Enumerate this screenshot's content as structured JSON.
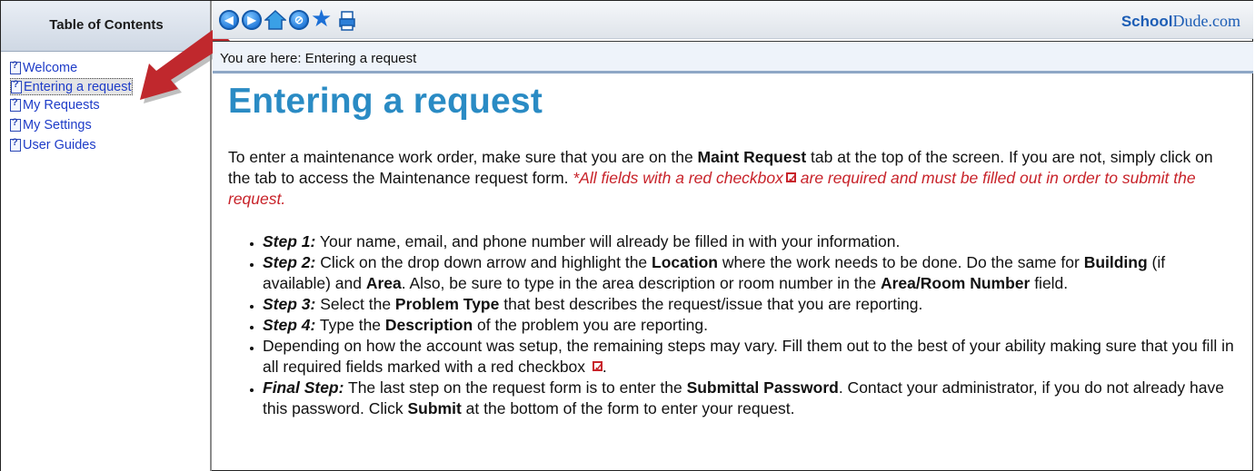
{
  "toc": {
    "title": "Table of Contents",
    "items": [
      {
        "label": "Welcome"
      },
      {
        "label": "Entering a request",
        "active": true
      },
      {
        "label": "My Requests"
      },
      {
        "label": "My Settings"
      },
      {
        "label": "User Guides"
      }
    ]
  },
  "toolbar": {
    "buttons": [
      "back-icon",
      "forward-icon",
      "home-icon",
      "stop-icon",
      "favorites-star-icon",
      "print-icon"
    ],
    "brand_bold": "School",
    "brand_rest": "Dude.com"
  },
  "breadcrumb": "You are here: Entering a request",
  "content": {
    "title": "Entering a request",
    "intro": {
      "p1": "To enter a maintenance work order, make sure that you are on the ",
      "b1": "Maint Request",
      "p2": " tab at the top of the screen. If you are not, simply click on the tab to access the Maintenance request form. ",
      "req1": "*All fields with a red checkbox",
      "req2": " are required and must be filled out in order to submit the request."
    },
    "steps": {
      "s1_label": "Step 1:",
      "s1_text": " Your name, email, and phone number will already be filled in with your information.",
      "s2_label": "Step 2:",
      "s2_t1": " Click on the drop down arrow and highlight the ",
      "s2_b1": "Location",
      "s2_t2": " where the work needs to be done. Do the same for ",
      "s2_b2": "Building",
      "s2_t3": " (if available) and ",
      "s2_b3": "Area",
      "s2_t4": ". Also, be sure to type in the area description or room number in the ",
      "s2_b4": "Area/Room Number",
      "s2_t5": " field.",
      "s3_label": "Step 3:",
      "s3_t1": " Select the ",
      "s3_b1": "Problem Type",
      "s3_t2": " that best describes the request/issue that you are reporting.",
      "s4_label": "Step 4:",
      "s4_t1": " Type the ",
      "s4_b1": "Description",
      "s4_t2": " of the problem you are reporting.",
      "s5_text": "Depending on how the account was setup, the remaining steps may vary. Fill them out to the best of your ability making sure that you fill in all required fields marked with a red checkbox ",
      "s5_end": ".",
      "s6_label": "Final Step:",
      "s6_t1": " The last step on the request form is to enter the ",
      "s6_b1": "Submittal Password",
      "s6_t2": ". Contact your administrator, if you do not already have this password. Click ",
      "s6_b2": "Submit",
      "s6_t3": " at the bottom of the form to enter your request."
    }
  },
  "colors": {
    "title": "#2a8bc4",
    "required_red": "#c8232a",
    "link_blue": "#1e3cc8",
    "arrow_red": "#c0282d"
  }
}
